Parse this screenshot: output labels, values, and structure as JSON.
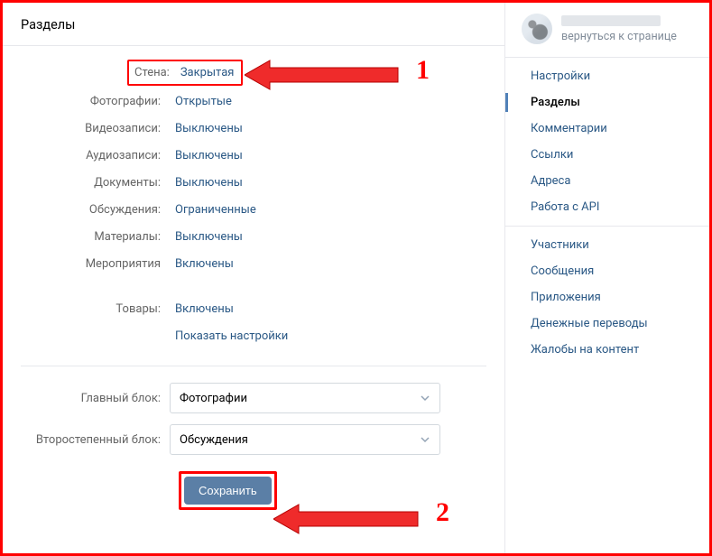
{
  "header": {
    "title": "Разделы"
  },
  "sections": [
    {
      "label": "Стена:",
      "value": "Закрытая",
      "highlighted": true
    },
    {
      "label": "Фотографии:",
      "value": "Открытые"
    },
    {
      "label": "Видеозаписи:",
      "value": "Выключены"
    },
    {
      "label": "Аудиозаписи:",
      "value": "Выключены"
    },
    {
      "label": "Документы:",
      "value": "Выключены"
    },
    {
      "label": "Обсуждения:",
      "value": "Ограниченные"
    },
    {
      "label": "Материалы:",
      "value": "Выключены"
    },
    {
      "label": "Мероприятия",
      "value": "Включены"
    }
  ],
  "goods": {
    "label": "Товары:",
    "value": "Включены",
    "show_settings": "Показать настройки"
  },
  "blocks": {
    "main": {
      "label": "Главный блок:",
      "value": "Фотографии"
    },
    "secondary": {
      "label": "Второстепенный блок:",
      "value": "Обсуждения"
    }
  },
  "save_label": "Сохранить",
  "annotations": {
    "one": "1",
    "two": "2"
  },
  "sidebar": {
    "back_label": "вернуться к странице",
    "group1": [
      "Настройки",
      "Разделы",
      "Комментарии",
      "Ссылки",
      "Адреса",
      "Работа с API"
    ],
    "active_index": 1,
    "group2": [
      "Участники",
      "Сообщения",
      "Приложения",
      "Денежные переводы",
      "Жалобы на контент"
    ]
  }
}
